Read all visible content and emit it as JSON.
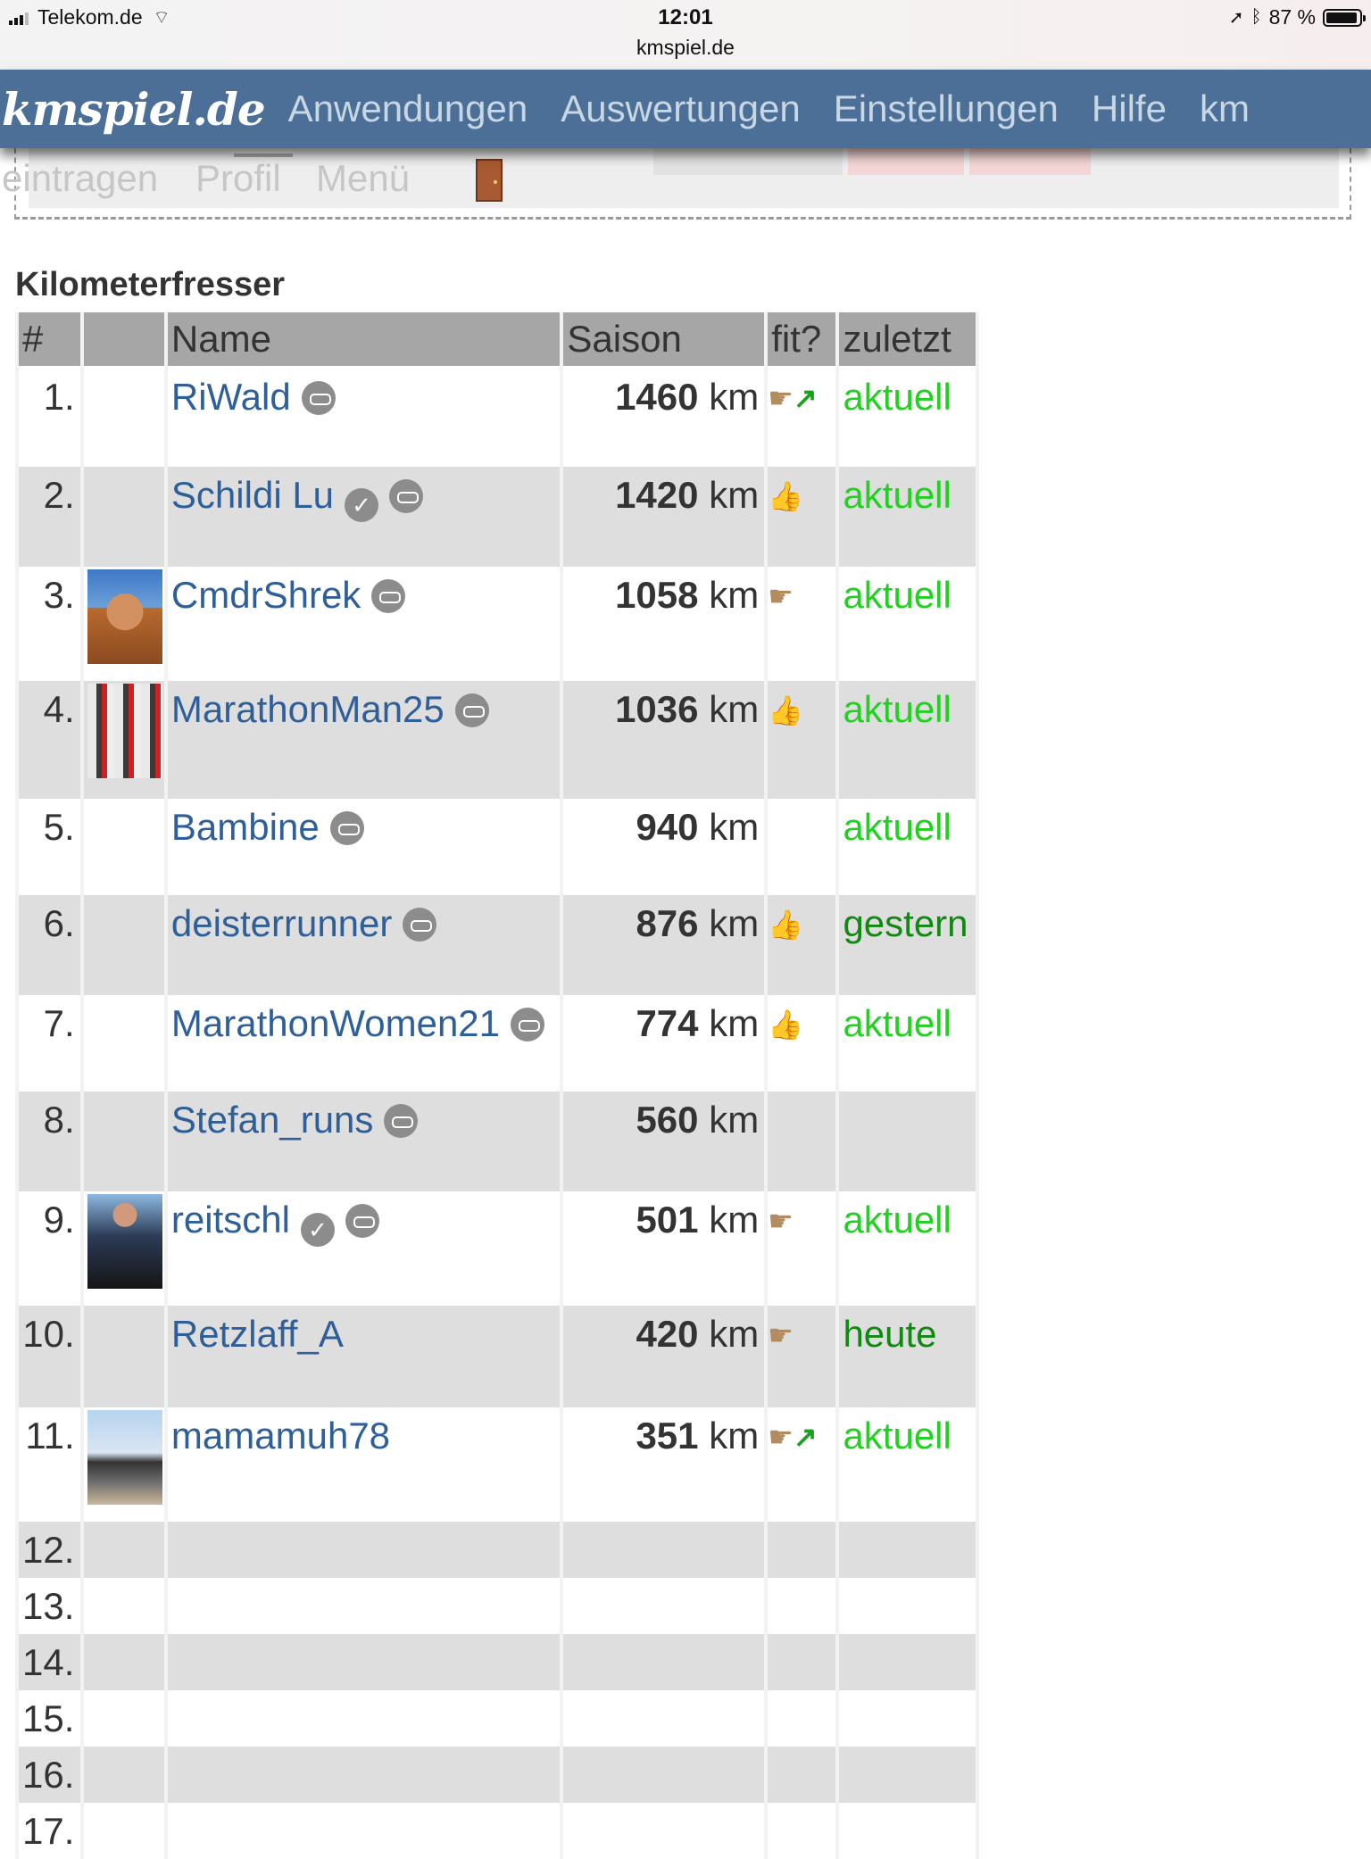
{
  "status_bar": {
    "carrier": "Telekom.de",
    "time": "12:01",
    "url": "kmspiel.de",
    "battery_text": "87 %",
    "battery_level": 0.87
  },
  "nav": {
    "logo": "kmspiel.de",
    "items": [
      "Anwendungen",
      "Auswertungen",
      "Einstellungen",
      "Hilfe",
      "km"
    ]
  },
  "submenu": {
    "items": [
      "eintragen",
      "Profil",
      "Menü"
    ],
    "door_icon": "door-icon"
  },
  "heading": "Kilometerfresser",
  "table": {
    "headers": [
      "#",
      "",
      "Name",
      "Saison",
      "fit?",
      "zuletzt"
    ],
    "rows": [
      {
        "rank": "1.",
        "name": "RiWald",
        "km": "1460",
        "unit": "km",
        "fit": [
          "pointing-hand-icon",
          "arrow-up-right-icon"
        ],
        "last": "aktuell",
        "last_state": "aktuell",
        "avatar": null,
        "verified": false,
        "badge": true
      },
      {
        "rank": "2.",
        "name": "Schildi Lu",
        "km": "1420",
        "unit": "km",
        "fit": [
          "thumbs-up-icon"
        ],
        "last": "aktuell",
        "last_state": "aktuell",
        "avatar": null,
        "verified": true,
        "badge": true
      },
      {
        "rank": "3.",
        "name": "CmdrShrek",
        "km": "1058",
        "unit": "km",
        "fit": [
          "pointing-hand-icon"
        ],
        "last": "aktuell",
        "last_state": "aktuell",
        "avatar": "av-cmdr",
        "verified": false,
        "badge": true
      },
      {
        "rank": "4.",
        "name": "MarathonMan25",
        "km": "1036",
        "unit": "km",
        "fit": [
          "thumbs-up-icon"
        ],
        "last": "aktuell",
        "last_state": "aktuell",
        "avatar": "av-marathon",
        "verified": false,
        "badge": true
      },
      {
        "rank": "5.",
        "name": "Bambine",
        "km": "940",
        "unit": "km",
        "fit": [],
        "last": "aktuell",
        "last_state": "aktuell",
        "avatar": null,
        "verified": false,
        "badge": true
      },
      {
        "rank": "6.",
        "name": "deisterrunner",
        "km": "876",
        "unit": "km",
        "fit": [
          "thumbs-up-icon"
        ],
        "last": "gestern",
        "last_state": "gestern",
        "avatar": null,
        "verified": false,
        "badge": true
      },
      {
        "rank": "7.",
        "name": "MarathonWomen21",
        "km": "774",
        "unit": "km",
        "fit": [
          "thumbs-up-icon"
        ],
        "last": "aktuell",
        "last_state": "aktuell",
        "avatar": null,
        "verified": false,
        "badge": true
      },
      {
        "rank": "8.",
        "name": "Stefan_runs",
        "km": "560",
        "unit": "km",
        "fit": [],
        "last": "",
        "last_state": "",
        "avatar": null,
        "verified": false,
        "badge": true
      },
      {
        "rank": "9.",
        "name": "reitschl",
        "km": "501",
        "unit": "km",
        "fit": [
          "pointing-hand-icon"
        ],
        "last": "aktuell",
        "last_state": "aktuell",
        "avatar": "av-reit",
        "verified": true,
        "badge": true
      },
      {
        "rank": "10.",
        "name": "Retzlaff_A",
        "km": "420",
        "unit": "km",
        "fit": [
          "pointing-hand-icon"
        ],
        "last": "heute",
        "last_state": "heute",
        "avatar": null,
        "verified": false,
        "badge": false
      },
      {
        "rank": "11.",
        "name": "mamamuh78",
        "km": "351",
        "unit": "km",
        "fit": [
          "pointing-hand-icon",
          "arrow-up-right-icon"
        ],
        "last": "aktuell",
        "last_state": "aktuell",
        "avatar": "av-mama",
        "verified": false,
        "badge": false
      }
    ],
    "empty_ranks": [
      "12.",
      "13.",
      "14.",
      "15.",
      "16.",
      "17."
    ]
  }
}
